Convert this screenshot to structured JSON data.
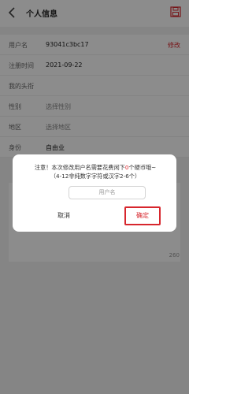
{
  "header": {
    "title": "个人信息"
  },
  "profile": {
    "rows": [
      {
        "label": "用户名",
        "value": "93041c3bc17",
        "action": "修改"
      },
      {
        "label": "注册时间",
        "value": "2021-09-22"
      },
      {
        "label": "我的头衔",
        "value": ""
      },
      {
        "label": "性别",
        "value": "选择性别",
        "placeholder": true
      },
      {
        "label": "地区",
        "value": "选择地区",
        "placeholder": true
      },
      {
        "label": "身份",
        "value": "自由业"
      }
    ],
    "bio_counter": "260"
  },
  "dialog": {
    "notice_prefix": "注意！本次修改用户名需要花费闲下",
    "coin_count": "0",
    "notice_suffix": "个硬币哦~",
    "notice_line2": "（4-12非纯数字字符或汉字2-6个）",
    "input_placeholder": "用户名",
    "cancel_label": "取消",
    "confirm_label": "确定"
  },
  "colors": {
    "accent": "#d7262d",
    "overlay": "rgba(0,0,0,0.45)"
  },
  "icons": {
    "back": "chevron-left-icon",
    "save": "save-icon"
  }
}
